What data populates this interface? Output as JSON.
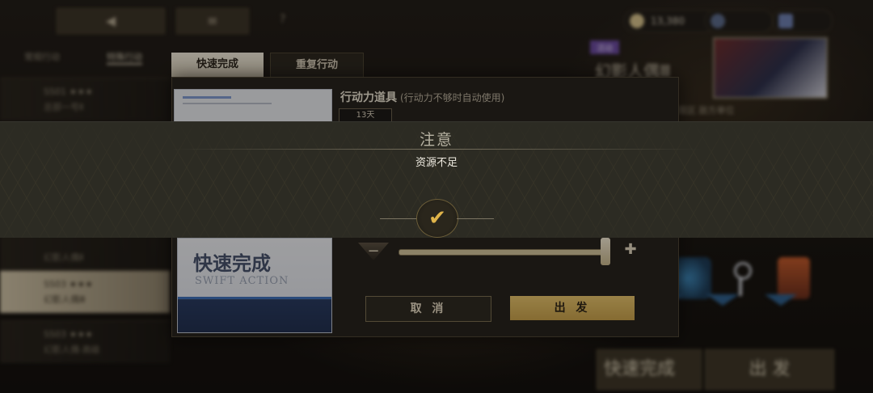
{
  "dialog": {
    "tabs": [
      "快速完成",
      "重复行动"
    ],
    "item": {
      "name": "行动力道具",
      "note": "(行动力不够时自动使用)",
      "days": "13天"
    },
    "card": {
      "title": "快速完成",
      "subtitle": "SWIFT ACTION"
    },
    "slider": {
      "value_fraction": 1.0
    },
    "buttons": {
      "cancel": "取 消",
      "go": "出 发"
    }
  },
  "notice": {
    "title": "注意",
    "message": "资源不足",
    "confirm_icon": "check-icon"
  },
  "background": {
    "resource_amount": "13,380",
    "right_panel_title": "幻影人偶Ⅲ",
    "bottom_buttons": [
      "快速完成",
      "出 发"
    ]
  },
  "colors": {
    "accent_gold": "#e0b44a",
    "go_button": "#d8b45c",
    "banner": "#2c2b23"
  }
}
